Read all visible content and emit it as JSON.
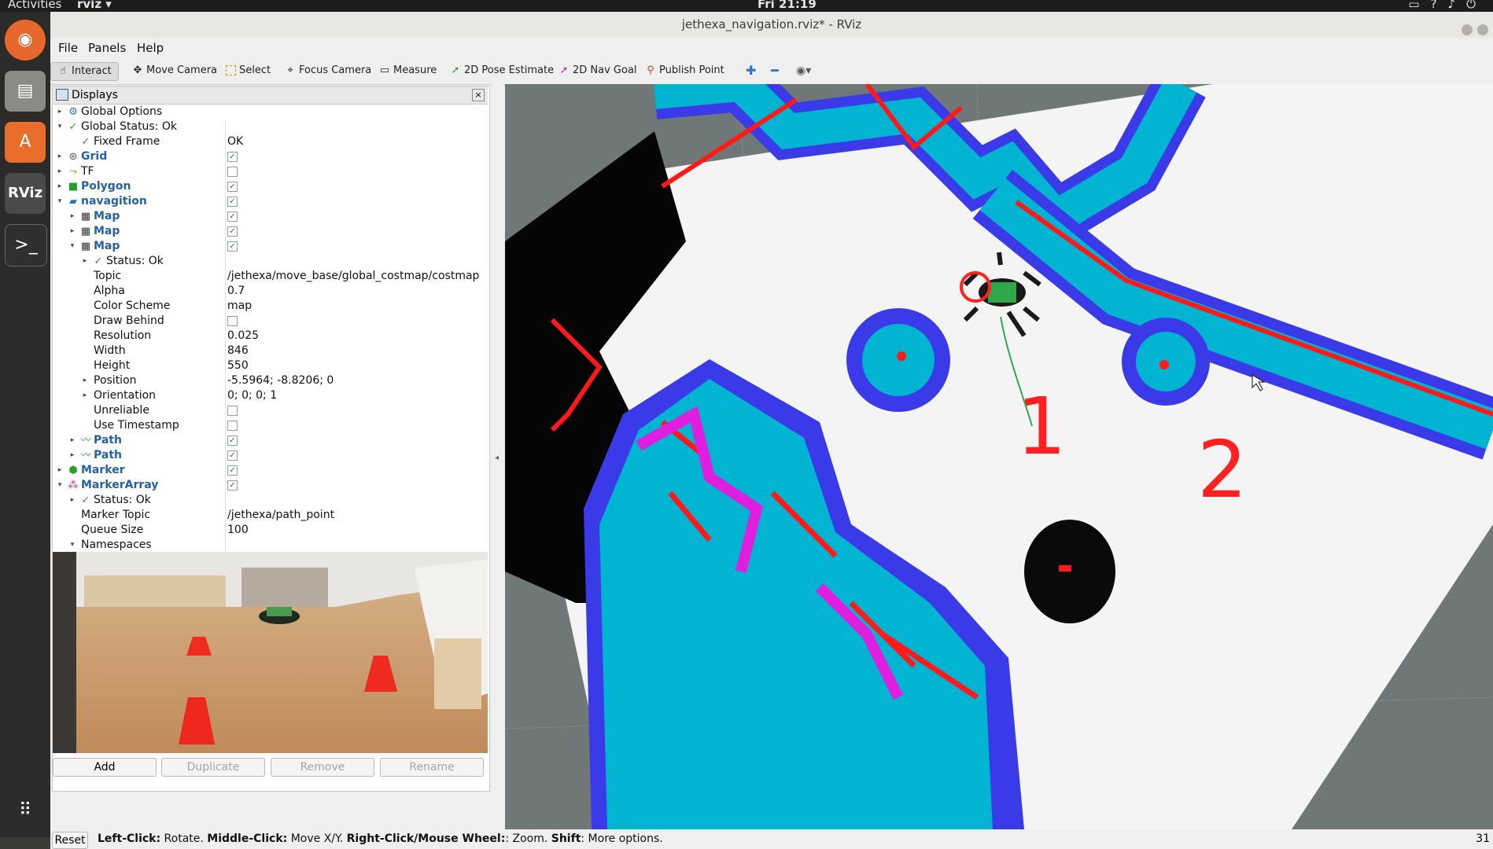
{
  "topbar": {
    "activities": "Activities",
    "app_name": "rviz ▾",
    "clock": "Fri 21:19"
  },
  "window": {
    "title": "jethexa_navigation.rviz* - RViz"
  },
  "menu": {
    "file": "File",
    "panels": "Panels",
    "help": "Help"
  },
  "toolbar": {
    "interact": "Interact",
    "move_camera": "Move Camera",
    "select": "Select",
    "focus_camera": "Focus Camera",
    "measure": "Measure",
    "pose_estimate": "2D Pose Estimate",
    "nav_goal": "2D Nav Goal",
    "publish_point": "Publish Point"
  },
  "displays": {
    "title": "Displays",
    "rows": [
      {
        "name": "Global Options",
        "value": ""
      },
      {
        "name": "Global Status: Ok",
        "value": ""
      },
      {
        "name": "Fixed Frame",
        "value": "OK"
      },
      {
        "name": "Grid",
        "checked": true
      },
      {
        "name": "TF",
        "checked": false
      },
      {
        "name": "Polygon",
        "checked": true
      },
      {
        "name": "navagition",
        "checked": true
      },
      {
        "name": "Map",
        "checked": true
      },
      {
        "name": "Map",
        "checked": true
      },
      {
        "name": "Map",
        "checked": true
      },
      {
        "name": "Status: Ok",
        "value": ""
      },
      {
        "name": "Topic",
        "value": "/jethexa/move_base/global_costmap/costmap"
      },
      {
        "name": "Alpha",
        "value": "0.7"
      },
      {
        "name": "Color Scheme",
        "value": "map"
      },
      {
        "name": "Draw Behind",
        "checked": false
      },
      {
        "name": "Resolution",
        "value": "0.025"
      },
      {
        "name": "Width",
        "value": "846"
      },
      {
        "name": "Height",
        "value": "550"
      },
      {
        "name": "Position",
        "value": "-5.5964; -8.8206; 0"
      },
      {
        "name": "Orientation",
        "value": "0; 0; 0; 1"
      },
      {
        "name": "Unreliable",
        "checked": false
      },
      {
        "name": "Use Timestamp",
        "checked": false
      },
      {
        "name": "Path",
        "checked": true
      },
      {
        "name": "Path",
        "checked": true
      },
      {
        "name": "Marker",
        "checked": true
      },
      {
        "name": "MarkerArray",
        "checked": true
      },
      {
        "name": "Status: Ok",
        "value": ""
      },
      {
        "name": "Marker Topic",
        "value": "/jethexa/path_point"
      },
      {
        "name": "Queue Size",
        "value": "100"
      },
      {
        "name": "Namespaces",
        "value": ""
      }
    ]
  },
  "buttons": {
    "add": "Add",
    "duplicate": "Duplicate",
    "remove": "Remove",
    "rename": "Rename"
  },
  "view": {
    "goal_labels": [
      "1",
      "2"
    ]
  },
  "statusbar": {
    "reset": "Reset",
    "lc": "Left-Click:",
    "lc_t": " Rotate. ",
    "mc": "Middle-Click:",
    "mc_t": " Move X/Y. ",
    "rc": "Right-Click/Mouse Wheel:",
    "rc_t": ": Zoom. ",
    "sh": "Shift",
    "sh_t": ": More options.",
    "fps": "31"
  },
  "colors": {
    "cyan": "#00b4d2",
    "blue": "#3a3ae8",
    "red": "#ff1a1a",
    "magenta": "#e01ee0",
    "robot_green": "#2fa84a"
  }
}
